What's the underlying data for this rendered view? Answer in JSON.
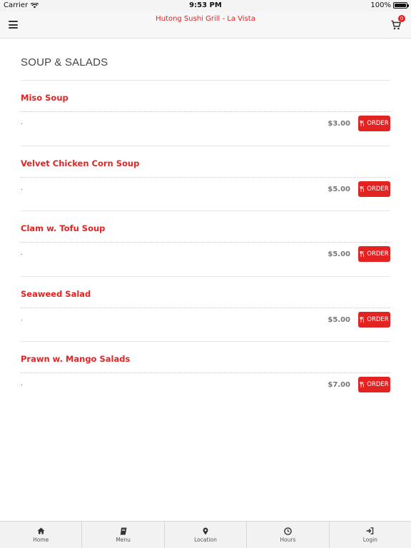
{
  "status_bar": {
    "carrier": "Carrier",
    "time": "9:53 PM",
    "battery": "100%",
    "battery_level": 1.0
  },
  "header": {
    "title": "Hutong Sushi Grill - La Vista",
    "cart_count": "0",
    "menu_icon": "hamburger-menu-icon",
    "cart_icon": "shopping-cart-icon"
  },
  "section": {
    "title": "SOUP & SALADS"
  },
  "items": [
    {
      "name": "Miso Soup",
      "desc": ".",
      "price": "$3.00",
      "order_label": "ORDER"
    },
    {
      "name": "Velvet Chicken Corn Soup",
      "desc": ".",
      "price": "$5.00",
      "order_label": "ORDER"
    },
    {
      "name": "Clam w. Tofu Soup",
      "desc": ".",
      "price": "$5.00",
      "order_label": "ORDER"
    },
    {
      "name": "Seaweed Salad",
      "desc": ".",
      "price": "$5.00",
      "order_label": "ORDER"
    },
    {
      "name": "Prawn w. Mango Salads",
      "desc": ".",
      "price": "$7.00",
      "order_label": "ORDER"
    }
  ],
  "tabs": [
    {
      "label": "Home",
      "icon": "home-icon"
    },
    {
      "label": "Menu",
      "icon": "book-icon"
    },
    {
      "label": "Location",
      "icon": "map-pin-icon"
    },
    {
      "label": "Hours",
      "icon": "clock-icon"
    },
    {
      "label": "Login",
      "icon": "login-icon"
    }
  ],
  "colors": {
    "accent": "#e32222",
    "header_bg": "#f7f7f7",
    "tabbar_bg": "#f2f2f2"
  }
}
